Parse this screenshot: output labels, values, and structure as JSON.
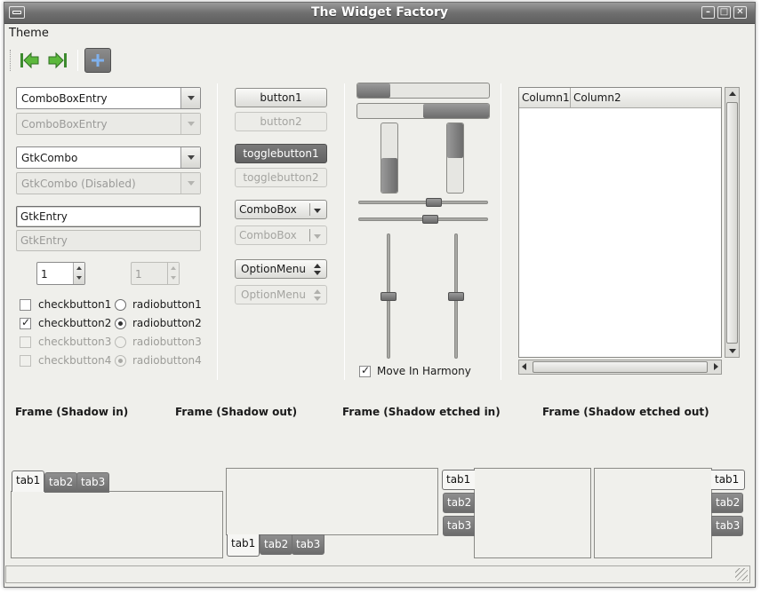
{
  "window": {
    "title": "The Widget Factory"
  },
  "menubar": {
    "theme": "Theme"
  },
  "toolbar": {
    "back_icon": "go-first-icon",
    "forward_icon": "go-last-icon",
    "add_icon": "add-icon"
  },
  "col1": {
    "combo_entry": "ComboBoxEntry",
    "combo_entry_disabled": "ComboBoxEntry",
    "gtk_combo": "GtkCombo",
    "gtk_combo_disabled": "GtkCombo (Disabled)",
    "entry": "GtkEntry",
    "entry_disabled": "GtkEntry",
    "spin": "1",
    "spin_disabled": "1",
    "checks": [
      "checkbutton1",
      "checkbutton2",
      "checkbutton3",
      "checkbutton4"
    ],
    "radios": [
      "radiobutton1",
      "radiobutton2",
      "radiobutton3",
      "radiobutton4"
    ]
  },
  "col2": {
    "button1": "button1",
    "button2": "button2",
    "toggle1": "togglebutton1",
    "toggle2": "togglebutton2",
    "combobox": "ComboBox",
    "combobox_disabled": "ComboBox",
    "optionmenu": "OptionMenu",
    "optionmenu_disabled": "OptionMenu"
  },
  "col3": {
    "harmony": "Move In Harmony",
    "progress": {
      "h1": 0.5,
      "h2": 0.5,
      "v1": 0.5,
      "v2": 0.5
    },
    "scales": {
      "h1": 0.5,
      "h2": 0.5,
      "v1": 0.5,
      "v2": 0.5
    }
  },
  "tree": {
    "columns": [
      "Column1",
      "Column2"
    ]
  },
  "frames": {
    "shadow_in": "Frame (Shadow in)",
    "shadow_out": "Frame (Shadow out)",
    "shadow_etched_in": "Frame (Shadow etched in)",
    "shadow_etched_out": "Frame (Shadow etched out)"
  },
  "tabs": [
    "tab1",
    "tab2",
    "tab3"
  ],
  "colors": {
    "accent": "#5b8ed6",
    "title_bg": "#6f6f6f",
    "window_bg": "#efefeb"
  }
}
